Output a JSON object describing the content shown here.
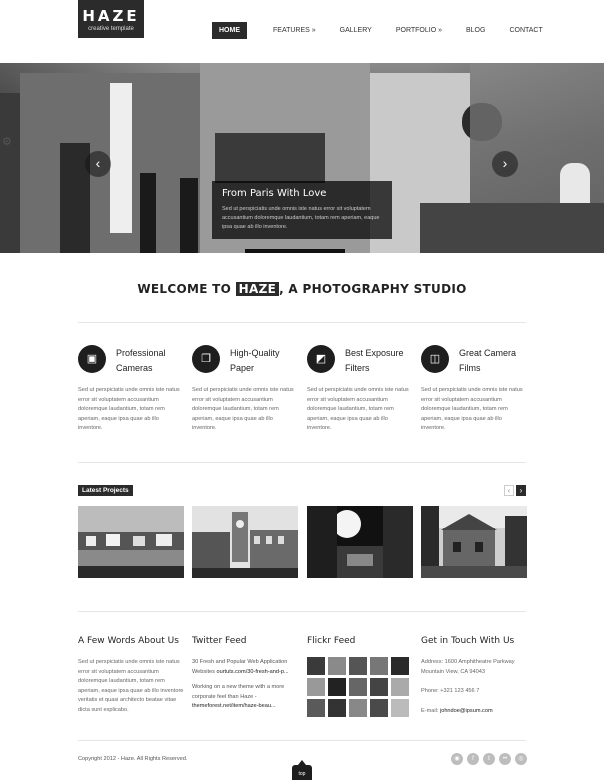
{
  "header": {
    "logo_name": "HAZE",
    "logo_tagline": "creative template",
    "nav": [
      "HOME",
      "FEATURES »",
      "GALLERY",
      "PORTFOLIO »",
      "BLOG",
      "CONTACT"
    ]
  },
  "slider": {
    "caption_title": "From Paris With Love",
    "caption_body": "Sed ut perspiciatis unde omnis iste natus error sit voluptatem accusantium doloremque laudantium, totam rem aperiam, eaque ipsa quae ab illo inventore.",
    "prev_icon": "‹",
    "next_icon": "›",
    "settings_icon": "⚙"
  },
  "welcome": {
    "before": "WELCOME TO ",
    "highlight": "HAZE",
    "after": ", A PHOTOGRAPHY STUDIO"
  },
  "features": [
    {
      "title": "Professional Cameras",
      "icon": "camera-icon",
      "glyph": "▣",
      "body": "Sed ut perspiciatis unde omnis iste natus error sit voluptatem accusantium doloremque laudantium, totam rem aperiam, eaque ipsa quae ab illo inventore."
    },
    {
      "title": "High-Quality Paper",
      "icon": "photo-paper-icon",
      "glyph": "❐",
      "body": "Sed ut perspiciatis unde omnis iste natus error sit voluptatem accusantium doloremque laudantium, totam rem aperiam, eaque ipsa quae ab illo inventore."
    },
    {
      "title": "Best Exposure Filters",
      "icon": "filters-icon",
      "glyph": "◩",
      "body": "Sed ut perspiciatis unde omnis iste natus error sit voluptatem accusantium doloremque laudantium, totam rem aperiam, eaque ipsa quae ab illo inventore."
    },
    {
      "title": "Great Camera Films",
      "icon": "film-roll-icon",
      "glyph": "◫",
      "body": "Sed ut perspiciatis unde omnis iste natus error sit voluptatem accusantium doloremque laudantium, totam rem aperiam, eaque ipsa quae ab illo inventore."
    }
  ],
  "latest_projects": {
    "title": "Latest Projects",
    "prev": "‹",
    "next": "›"
  },
  "about": {
    "heading": "A Few Words About Us",
    "text": "Sed ut perspiciatis unde omnis iste natus error sit voluptatem accusantium doloremque laudantium, totam rem aperiam, eaque ipsa quae ab illo inventore veritatis et quasi architecto beatae vitae dicta sunt explicabo."
  },
  "twitter": {
    "heading": "Twitter Feed",
    "tweet1_text": "30 Fresh and Popular Web Application Websites ",
    "tweet1_link": "ourtuts.com/30-fresh-and-p...",
    "tweet2_text": "Working on a new theme with a more corporate feel than Haze - ",
    "tweet2_link": "themeforest.net/item/haze-beau..."
  },
  "flickr": {
    "heading": "Flickr Feed"
  },
  "contact": {
    "heading": "Get in Touch With Us",
    "address_line1": "Address: 1600 Amphitheatre Parkway",
    "address_line2": "Mountain View, CA 94043",
    "phone": "Phone: +321 123 456 7",
    "email_label": "E-mail: ",
    "email": "johndoe@ipsum.com"
  },
  "footer": {
    "copyright": "Copyright 2012 - Haze. All Rights Reserved.",
    "socials": [
      "rss-icon",
      "facebook-icon",
      "twitter-icon",
      "flickr-icon",
      "dribbble-icon"
    ],
    "top_label": "top"
  }
}
